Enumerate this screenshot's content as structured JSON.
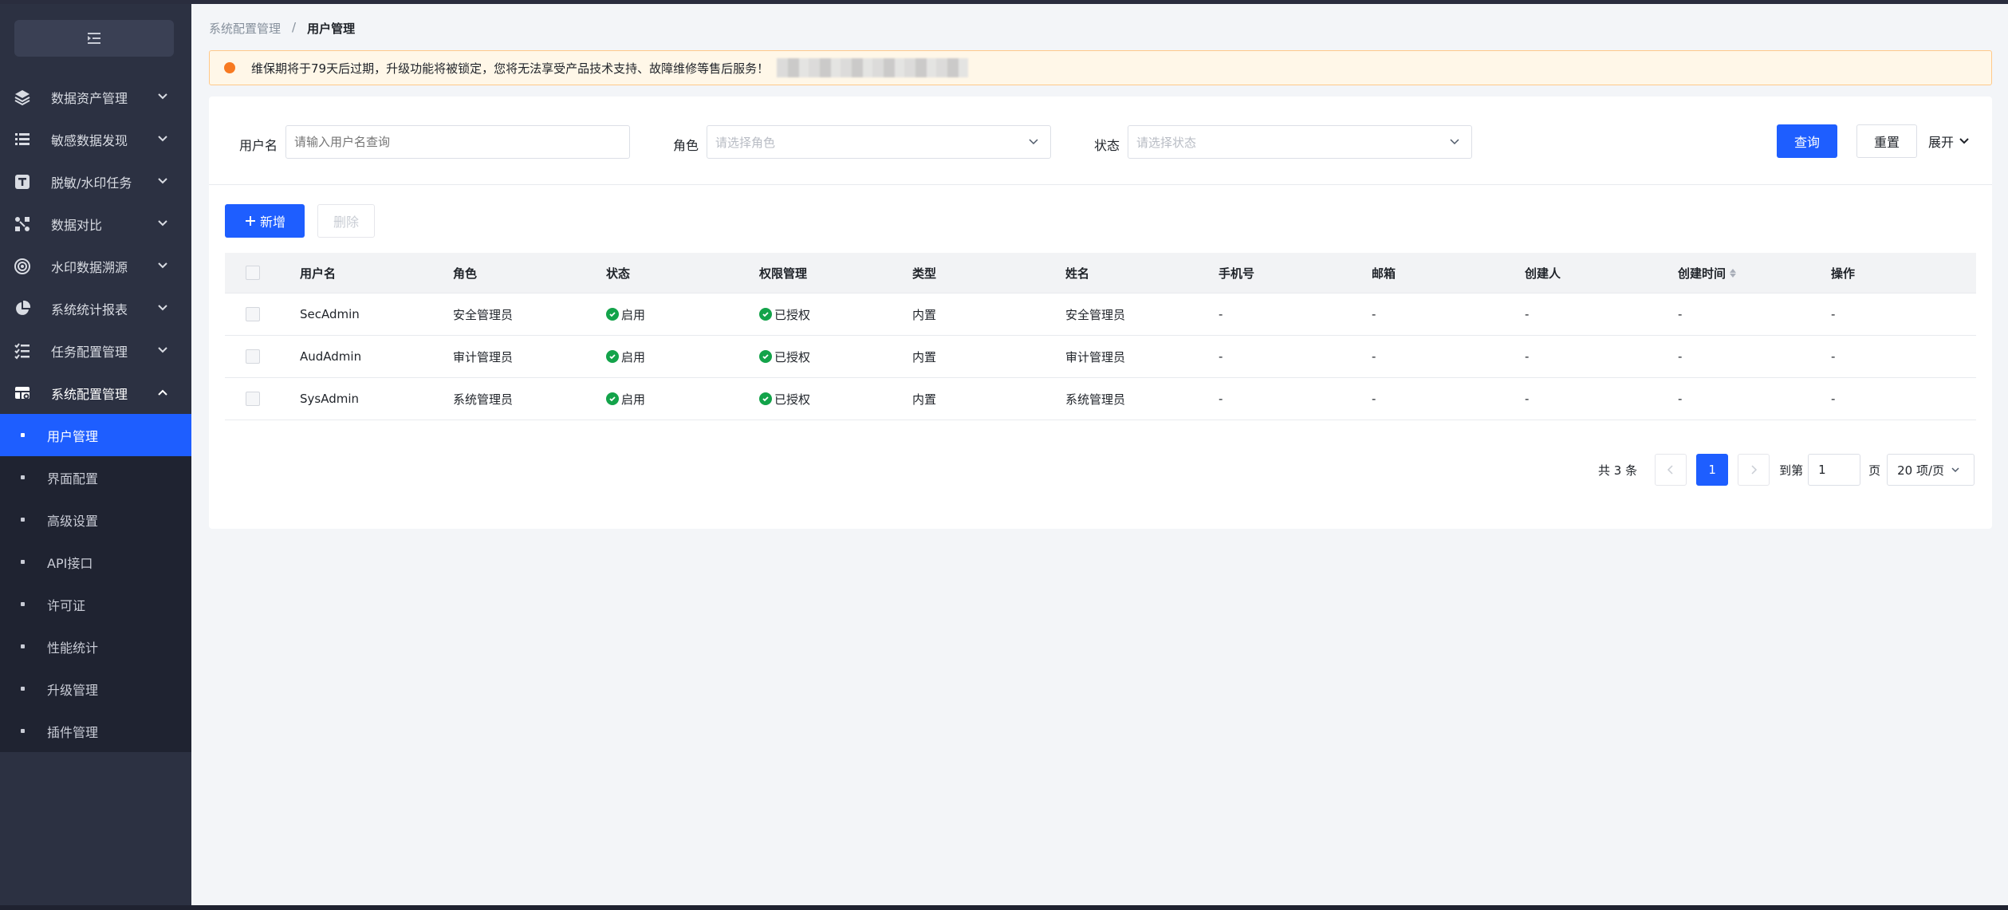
{
  "sidebar": {
    "items": [
      {
        "label": "数据资产管理",
        "icon": "layers-icon"
      },
      {
        "label": "敏感数据发现",
        "icon": "list-icon"
      },
      {
        "label": "脱敏/水印任务",
        "icon": "text-box-icon"
      },
      {
        "label": "数据对比",
        "icon": "compare-icon"
      },
      {
        "label": "水印数据溯源",
        "icon": "target-icon"
      },
      {
        "label": "系统统计报表",
        "icon": "pie-chart-icon"
      },
      {
        "label": "任务配置管理",
        "icon": "checklist-icon"
      },
      {
        "label": "系统配置管理",
        "icon": "settings-table-icon"
      }
    ],
    "subitems": [
      {
        "label": "用户管理",
        "active": true
      },
      {
        "label": "界面配置"
      },
      {
        "label": "高级设置"
      },
      {
        "label": "API接口"
      },
      {
        "label": "许可证"
      },
      {
        "label": "性能统计"
      },
      {
        "label": "升级管理"
      },
      {
        "label": "插件管理"
      }
    ]
  },
  "breadcrumb": {
    "parent": "系统配置管理",
    "separator": "/",
    "current": "用户管理"
  },
  "alert": {
    "text": "维保期将于79天后过期，升级功能将被锁定，您将无法享受产品技术支持、故障维修等售后服务！"
  },
  "filters": {
    "username_label": "用户名",
    "username_placeholder": "请输入用户名查询",
    "role_label": "角色",
    "role_placeholder": "请选择角色",
    "status_label": "状态",
    "status_placeholder": "请选择状态",
    "query": "查询",
    "reset": "重置",
    "expand": "展开"
  },
  "toolbar": {
    "add": "新增",
    "delete": "删除"
  },
  "table": {
    "columns": [
      "用户名",
      "角色",
      "状态",
      "权限管理",
      "类型",
      "姓名",
      "手机号",
      "邮箱",
      "创建人",
      "创建时间",
      "操作"
    ],
    "rows": [
      [
        "SecAdmin",
        "安全管理员",
        "启用",
        "已授权",
        "内置",
        "安全管理员",
        "-",
        "-",
        "-",
        "-",
        "-"
      ],
      [
        "AudAdmin",
        "审计管理员",
        "启用",
        "已授权",
        "内置",
        "审计管理员",
        "-",
        "-",
        "-",
        "-",
        "-"
      ],
      [
        "SysAdmin",
        "系统管理员",
        "启用",
        "已授权",
        "内置",
        "系统管理员",
        "-",
        "-",
        "-",
        "-",
        "-"
      ]
    ]
  },
  "pagination": {
    "total": "共 3 条",
    "current": "1",
    "goto_label": "到第",
    "goto_value": "1",
    "page_unit": "页",
    "page_size": "20 项/页"
  },
  "colors": {
    "primary": "#1e5eff",
    "sidebar": "#2c3142",
    "success": "#13a34a",
    "warning": "#f77a22"
  }
}
